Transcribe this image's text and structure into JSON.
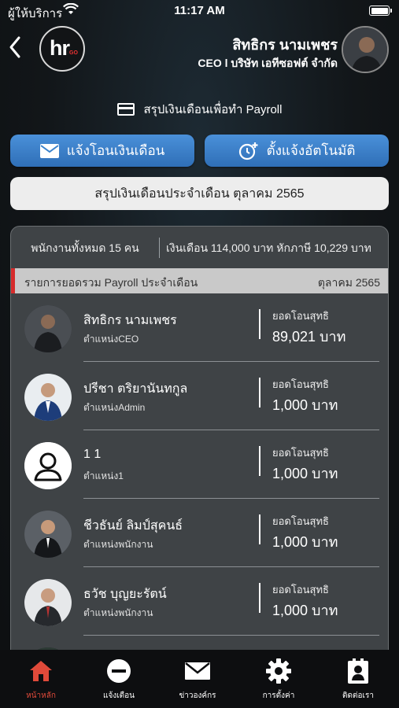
{
  "status_bar": {
    "carrier": "ผู้ให้บริการ",
    "time": "11:17 AM"
  },
  "header": {
    "logo_text": "hr",
    "logo_sub": "GO",
    "user_name": "สิทธิกร นามเพชร",
    "user_role": "CEO l บริษัท เอทีซอฟต์ จำกัด"
  },
  "summary_title": "สรุปเงินเดือนเพื่อทำ Payroll",
  "buttons": {
    "transfer": "แจ้งโอนเงินเดือน",
    "auto": "ตั้งแจ้งอัตโนมัติ",
    "month_summary": "สรุปเงินเดือนประจำเดือน ตุลาคม 2565"
  },
  "panel": {
    "employee_count": "พนักงานทั้งหมด 15 คน",
    "salary_summary": "เงินเดือน 114,000 บาท หักภาษี 10,229 บาท",
    "list_title": "รายการยอดรวม Payroll ประจำเดือน",
    "list_month": "ตุลาคม 2565",
    "employees": [
      {
        "name": "สิทธิกร นามเพชร",
        "position": "ตำแหน่งCEO",
        "net_label": "ยอดโอนสุทธิ",
        "net_value": "89,021 บาท"
      },
      {
        "name": "ปรีชา ตริยานันทกูล",
        "position": "ตำแหน่งAdmin",
        "net_label": "ยอดโอนสุทธิ",
        "net_value": "1,000 บาท"
      },
      {
        "name": "1 1",
        "position": "ตำแหน่ง1",
        "net_label": "ยอดโอนสุทธิ",
        "net_value": "1,000 บาท"
      },
      {
        "name": "ชีวธันย์ ลิมป์สุคนธ์",
        "position": "ตำแหน่งพนักงาน",
        "net_label": "ยอดโอนสุทธิ",
        "net_value": "1,000 บาท"
      },
      {
        "name": "ธวัช บุญยะรัตน์",
        "position": "ตำแหน่งพนักงาน",
        "net_label": "ยอดโอนสุทธิ",
        "net_value": "1,000 บาท"
      }
    ]
  },
  "tabs": [
    {
      "label": "หน้าหลัก",
      "icon": "home-icon",
      "active": true
    },
    {
      "label": "แจ้งเตือน",
      "icon": "minus-circle-icon",
      "active": false
    },
    {
      "label": "ข่าวองค์กร",
      "icon": "mail-icon",
      "active": false
    },
    {
      "label": "การตั้งค่า",
      "icon": "gear-icon",
      "active": false
    },
    {
      "label": "ติดต่อเรา",
      "icon": "contact-badge-icon",
      "active": false
    }
  ],
  "colors": {
    "accent_blue": "#3a82cc",
    "active_tab": "#e04a3a",
    "bar_marker": "#d62b2b"
  }
}
